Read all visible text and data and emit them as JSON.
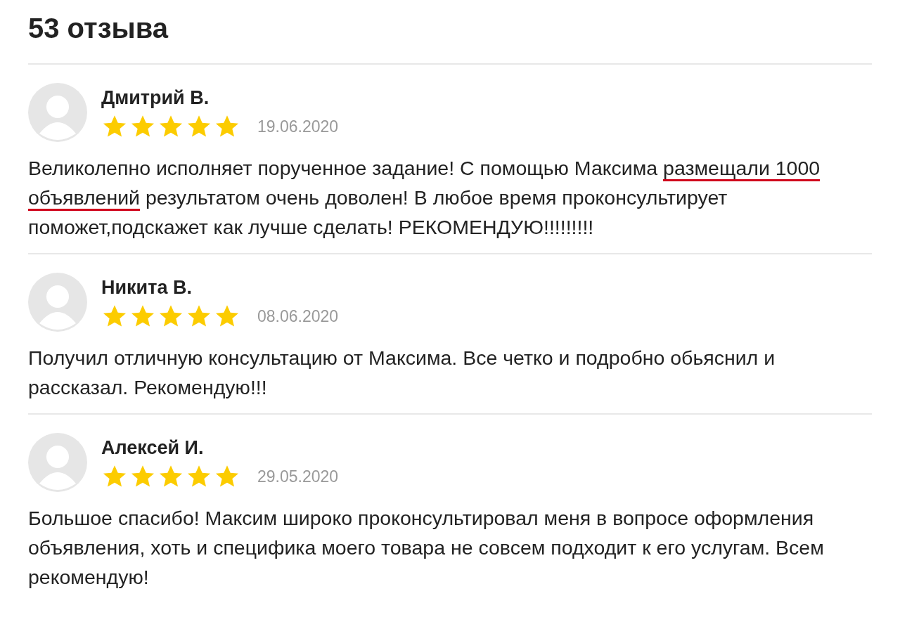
{
  "title": "53 отзыва",
  "reviews": [
    {
      "name": "Дмитрий В.",
      "stars": 5,
      "date": "19.06.2020",
      "text": [
        {
          "text": "Великолепно исполняет порученное задание! С помощью Максима ",
          "underlined": false
        },
        {
          "text": "размещали 1000 объявлений",
          "underlined": true
        },
        {
          "text": " результатом очень доволен! В любое время проконсультирует поможет,подскажет как лучше сделать! РЕКОМЕНДУЮ!!!!!!!!!",
          "underlined": false
        }
      ]
    },
    {
      "name": "Никита В.",
      "stars": 5,
      "date": "08.06.2020",
      "text": [
        {
          "text": "Получил отличную консультацию от Максима. Все четко и подробно обьяснил и рассказал. Рекомендую!!!",
          "underlined": false
        }
      ]
    },
    {
      "name": "Алексей И.",
      "stars": 5,
      "date": "29.05.2020",
      "text": [
        {
          "text": "Большое спасибо! Максим широко проконсультировал меня в вопросе оформления объявления, хоть и специфика моего товара не совсем подходит к его услугам. Всем рекомендую!",
          "underlined": false
        }
      ]
    }
  ]
}
